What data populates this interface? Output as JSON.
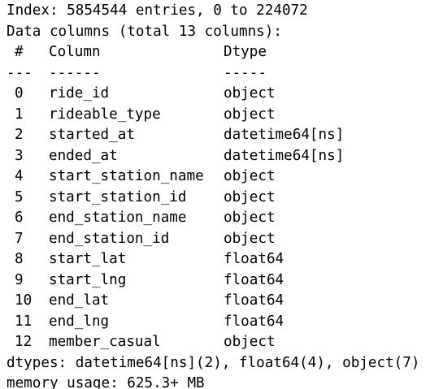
{
  "output": {
    "index_line": "Index: 5854544 entries, 0 to 224072",
    "columns_line": "Data columns (total 13 columns):",
    "header": {
      "idx": "#",
      "column": "Column",
      "dtype": "Dtype"
    },
    "separator": {
      "idx": "---",
      "column": "------",
      "dtype": "-----"
    },
    "rows": [
      {
        "idx": "0",
        "column": "ride_id",
        "dtype": "object"
      },
      {
        "idx": "1",
        "column": "rideable_type",
        "dtype": "object"
      },
      {
        "idx": "2",
        "column": "started_at",
        "dtype": "datetime64[ns]"
      },
      {
        "idx": "3",
        "column": "ended_at",
        "dtype": "datetime64[ns]"
      },
      {
        "idx": "4",
        "column": "start_station_name",
        "dtype": "object"
      },
      {
        "idx": "5",
        "column": "start_station_id",
        "dtype": "object"
      },
      {
        "idx": "6",
        "column": "end_station_name",
        "dtype": "object"
      },
      {
        "idx": "7",
        "column": "end_station_id",
        "dtype": "object"
      },
      {
        "idx": "8",
        "column": "start_lat",
        "dtype": "float64"
      },
      {
        "idx": "9",
        "column": "start_lng",
        "dtype": "float64"
      },
      {
        "idx": "10",
        "column": "end_lat",
        "dtype": "float64"
      },
      {
        "idx": "11",
        "column": "end_lng",
        "dtype": "float64"
      },
      {
        "idx": "12",
        "column": "member_casual",
        "dtype": "object"
      }
    ],
    "dtypes_line": "dtypes: datetime64[ns](2), float64(4), object(7)",
    "memory_line": "memory usage: 625.3+ MB"
  }
}
